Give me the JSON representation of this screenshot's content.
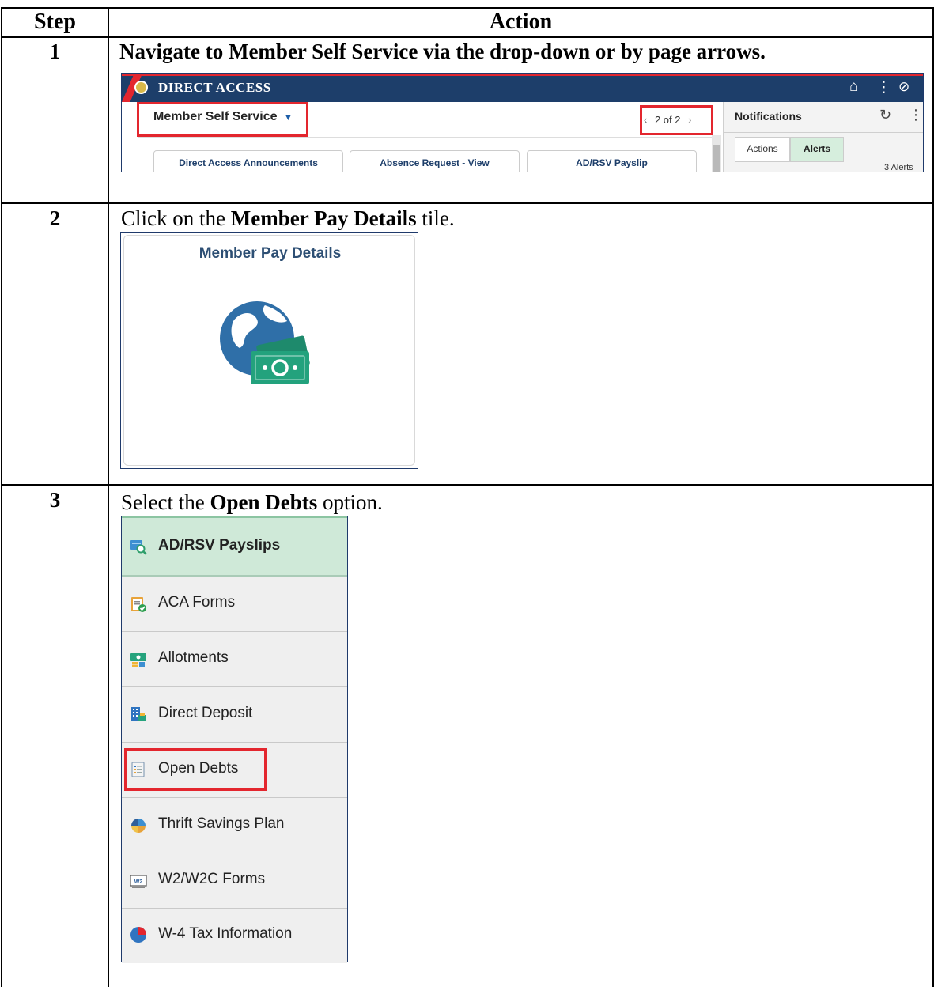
{
  "table": {
    "headers": {
      "step": "Step",
      "action": "Action"
    },
    "rows": [
      {
        "step": "1",
        "instruction_bold": "Navigate to Member Self Service via the drop-down or by page arrows."
      },
      {
        "step": "2",
        "instruction_pre": "Click on the ",
        "instruction_bold": "Member Pay Details",
        "instruction_post": " tile."
      },
      {
        "step": "3",
        "instruction_pre": "Select the ",
        "instruction_bold": "Open Debts",
        "instruction_post": " option."
      }
    ]
  },
  "direct_access": {
    "brand": "DIRECT ACCESS",
    "home_icon": "home-icon",
    "homepage_title": "Member Self Service",
    "dropdown_caret": "▼",
    "prev_arrow": "‹",
    "next_arrow": "›",
    "page_indicator": "2 of 2",
    "tiles": [
      "Direct Access Announcements",
      "Absence Request - View",
      "AD/RSV Payslip"
    ],
    "notifications": {
      "title": "Notifications",
      "tabs": [
        "Actions",
        "Alerts"
      ],
      "active_tab": "Alerts",
      "count_text": "3 Alerts"
    },
    "colors": {
      "header_bg": "#1d3e6a",
      "accent_red": "#e3262e",
      "alerts_green": "#d6eedd"
    }
  },
  "member_pay_tile": {
    "title": "Member Pay Details",
    "icon": "globe-money-icon"
  },
  "pay_menu": {
    "items": [
      {
        "label": "AD/RSV Payslips",
        "icon": "payslip-search-icon",
        "selected": true
      },
      {
        "label": "ACA Forms",
        "icon": "clipboard-check-icon"
      },
      {
        "label": "Allotments",
        "icon": "allotments-icon"
      },
      {
        "label": "Direct Deposit",
        "icon": "building-deposit-icon"
      },
      {
        "label": "Open Debts",
        "icon": "ledger-icon",
        "highlighted": true
      },
      {
        "label": "Thrift Savings Plan",
        "icon": "piggy-bank-icon"
      },
      {
        "label": "W2/W2C Forms",
        "icon": "w2-form-icon",
        "icon_text": "W2"
      },
      {
        "label": "W-4 Tax Information",
        "icon": "pie-chart-icon"
      }
    ]
  }
}
